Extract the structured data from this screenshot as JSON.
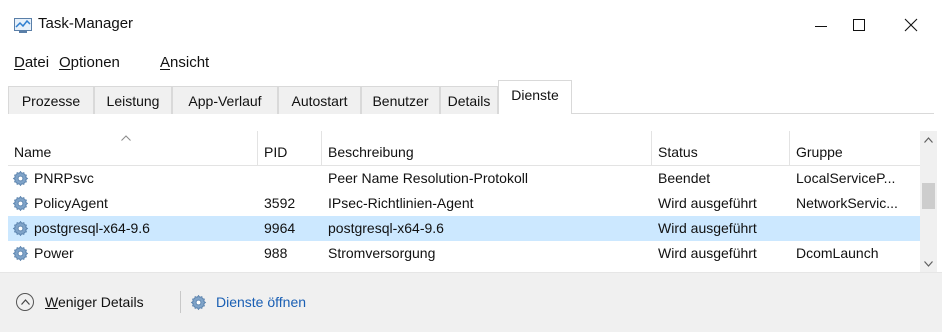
{
  "window": {
    "title": "Task-Manager",
    "controls": {
      "minimize": "minimize",
      "maximize": "maximize",
      "close": "close"
    }
  },
  "menu": [
    {
      "accel": "D",
      "rest": "atei"
    },
    {
      "accel": "O",
      "rest": "ptionen"
    },
    {
      "accel": "A",
      "rest": "nsicht"
    }
  ],
  "tabs": [
    "Prozesse",
    "Leistung",
    "App-Verlauf",
    "Autostart",
    "Benutzer",
    "Details",
    "Dienste"
  ],
  "active_tab": "Dienste",
  "table": {
    "columns": [
      "Name",
      "PID",
      "Beschreibung",
      "Status",
      "Gruppe"
    ],
    "sorted_column": "Name",
    "rows": [
      {
        "name": "PNRPsvc",
        "pid": "",
        "desc": "Peer Name Resolution-Protokoll",
        "status": "Beendet",
        "group": "LocalServiceP..."
      },
      {
        "name": "PolicyAgent",
        "pid": "3592",
        "desc": "IPsec-Richtlinien-Agent",
        "status": "Wird ausgeführt",
        "group": "NetworkServic..."
      },
      {
        "name": "postgresql-x64-9.6",
        "pid": "9964",
        "desc": "postgresql-x64-9.6",
        "status": "Wird ausgeführt",
        "group": ""
      },
      {
        "name": "Power",
        "pid": "988",
        "desc": "Stromversorgung",
        "status": "Wird ausgeführt",
        "group": "DcomLaunch"
      }
    ],
    "selected_row_index": 2
  },
  "footer": {
    "fewer_details_accel": "W",
    "fewer_details_rest": "eniger Details",
    "open_services": "Dienste öffnen"
  },
  "colors": {
    "selection": "#cce8ff",
    "link": "#1a5fb4",
    "footer_bg": "#f0f0f0"
  },
  "icons": {
    "app": "task-manager-icon",
    "service": "gear-icon",
    "fewer_details": "chevron-up-circle-icon"
  }
}
